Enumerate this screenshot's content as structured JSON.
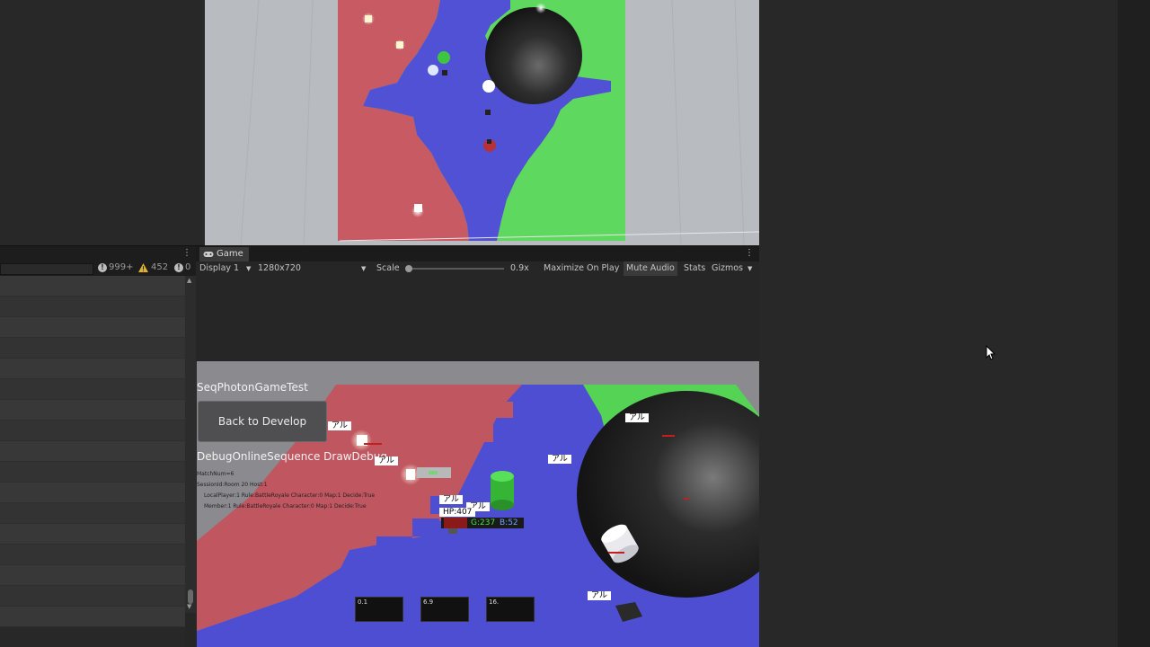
{
  "console": {
    "error_count": "999+",
    "warning_count": "452",
    "info_count": "0",
    "row_count": 17
  },
  "game_panel": {
    "tab_label": "Game",
    "display": "Display 1",
    "resolution": "1280x720",
    "scale_label": "Scale",
    "scale_value": "0.9x",
    "scale_fraction": 0.0,
    "maximize_on_play": "Maximize On Play",
    "mute_audio": "Mute Audio",
    "stats": "Stats",
    "gizmos": "Gizmos"
  },
  "game_ui": {
    "title": "SeqPhotonGameTest",
    "back_button": "Back to Develop",
    "debug_title": "DebugOnlineSequence DrawDebug",
    "debug_lines": [
      "MatchNum=6",
      "SessionId:Room 20 Host:1",
      "LocalPlayer:1  Rule:BattleRoyale Character:0 Map:1 Decide:True",
      "Member:1  Rule:BattleRoyale Character:0 Map:1 Decide:True"
    ],
    "name_tags": [
      "アル",
      "アル",
      "アル",
      "アル",
      "アル",
      "アル",
      "アル"
    ],
    "hp_label": "HP:407",
    "rgb_g": "G:237",
    "rgb_b": "B:52",
    "hud_values": [
      "0.1",
      "6.9",
      "16."
    ]
  },
  "colors": {
    "red_team": "#c0565f",
    "blue_team": "#4a4acf",
    "green_team": "#54d454"
  }
}
